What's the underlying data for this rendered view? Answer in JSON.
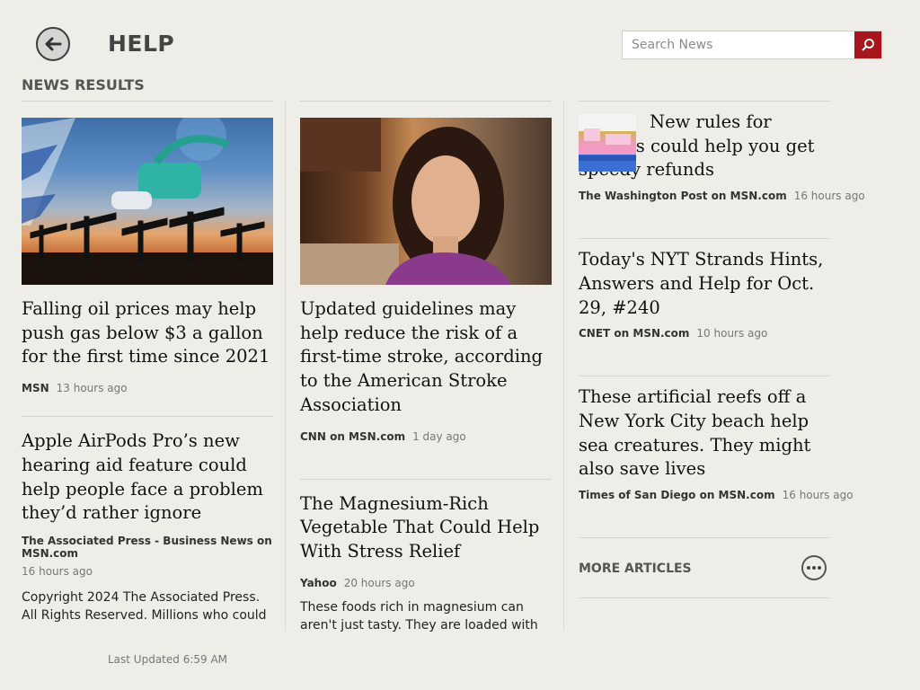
{
  "header": {
    "title": "HELP",
    "search": {
      "placeholder": "Search News",
      "value": ""
    }
  },
  "section": {
    "title": "NEWS RESULTS"
  },
  "articles": [
    {
      "headline": "Falling oil prices may help push gas below $3 a gallon for the first time since 2021",
      "source": "MSN",
      "time": "13 hours ago"
    },
    {
      "headline": "Apple AirPods Pro’s new hearing aid feature could help people face a problem they’d rather ignore",
      "source": "The Associated Press - Business News on MSN.com",
      "time": "16 hours ago",
      "snippet": "Copyright 2024 The Associated Press. All Rights Reserved. Millions who could"
    },
    {
      "headline": "Updated guidelines may help reduce the risk of a first-time stroke, according to the American Stroke Association",
      "source": "CNN on MSN.com",
      "time": "1 day ago"
    },
    {
      "headline": "The Magnesium-Rich Vegetable That Could Help With Stress Relief",
      "source": "Yahoo",
      "time": "20 hours ago",
      "snippet": "These foods rich in magnesium can aren't just tasty. They are loaded with the good-"
    },
    {
      "headline": "New rules for airlines could help you get speedy refunds",
      "source": "The Washington Post on MSN.com",
      "time": "16 hours ago"
    },
    {
      "headline": "Today's NYT Strands Hints, Answers and Help for Oct. 29, #240",
      "source": "CNET on MSN.com",
      "time": "10 hours ago"
    },
    {
      "headline": "These artificial reefs off a New York City beach help sea creatures. They might also save lives",
      "source": "Times of San Diego on MSN.com",
      "time": "16 hours ago"
    }
  ],
  "more_articles": {
    "label": "MORE ARTICLES"
  },
  "footer": {
    "last_updated": "Last Updated 6:59 AM"
  },
  "icons": {
    "back": "back-arrow-icon",
    "search": "search-icon",
    "more": "ellipsis-icon"
  },
  "colors": {
    "background": "#eeede8",
    "accent": "#a8161d"
  }
}
